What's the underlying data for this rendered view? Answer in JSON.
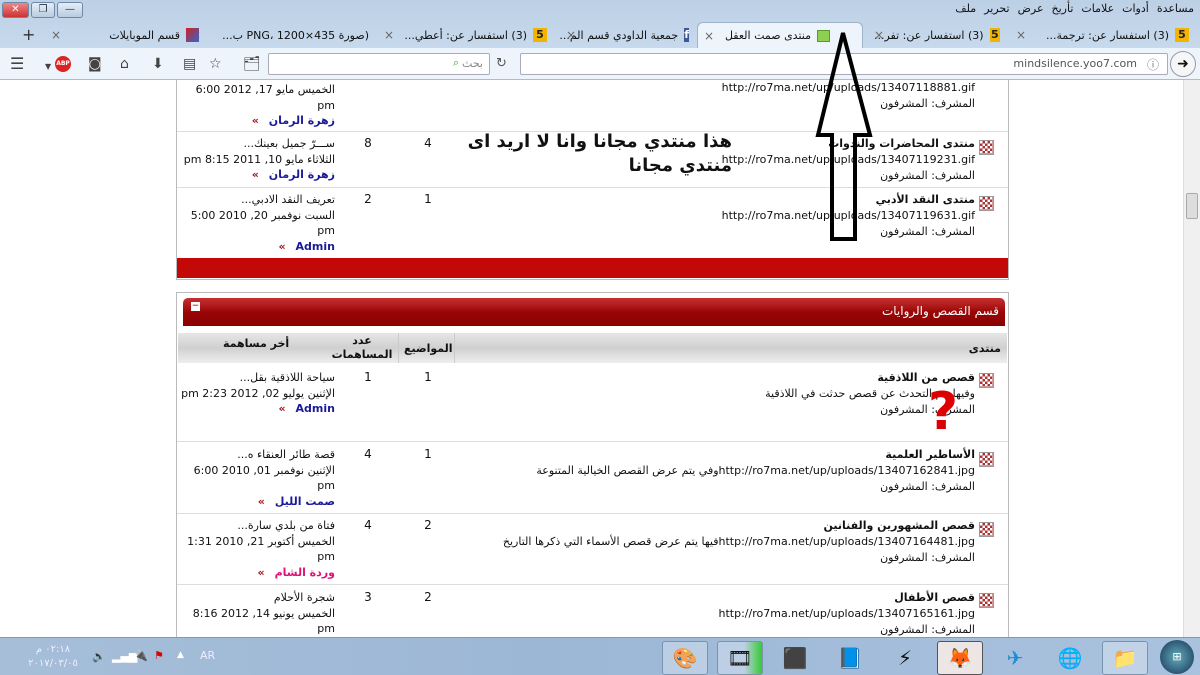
{
  "window": {
    "close": "✕",
    "restore": "❐",
    "minimize": "—"
  },
  "menu": [
    "ملف",
    "تحرير",
    "عرض",
    "تأريخ",
    "علامات",
    "أدوات",
    "مساعدة"
  ],
  "tabs": [
    {
      "label": "(3) استفسار عن: ترجمة...",
      "icon": "five-icon"
    },
    {
      "label": "(3) استفسار عن: تفر...",
      "icon": "five-icon"
    },
    {
      "label": "منتدى صمت العقل",
      "icon": "green-icon",
      "active": true
    },
    {
      "label": "جمعية الداودي قسم الم...",
      "icon": "facebook-icon"
    },
    {
      "label": "(3) استفسار عن: أعطي...",
      "icon": "five-icon"
    },
    {
      "label": "(صورة PNG، 1200×435 ب...",
      "icon": "image-icon"
    },
    {
      "label": "قسم الموبايلات",
      "icon": "site-icon"
    }
  ],
  "nav": {
    "url": "mindsilence.yoo7.com",
    "search_placeholder": "بحث",
    "abp": "ABP"
  },
  "annotation": {
    "line1": "هذا منتدي مجانا وانا لا اريد اى",
    "line2": "منتدي مجانا"
  },
  "section1": {
    "rows": [
      {
        "url": "http://ro7ma.net/up/uploads/13407118881.gif",
        "mod": "المشرف: المشرفون",
        "last_date": "الخميس مايو 17, 2012 6:00",
        "last_pm": "pm",
        "user": "زهرة الرمان"
      },
      {
        "name": "منتدى المحاضرات والندوات",
        "url": "http://ro7ma.net/up/uploads/13407119231.gif",
        "mod": "المشرف: المشرفون",
        "topics": "4",
        "posts": "8",
        "last_title": "ســـرّ جميل بعينك...",
        "last_date": "الثلاثاء مايو 10, 2011 8:15 pm",
        "user": "زهرة الرمان"
      },
      {
        "name": "منتدى النقد الأدبي",
        "url": "http://ro7ma.net/up/uploads/13407119631.gif",
        "mod": "المشرف: المشرفون",
        "topics": "1",
        "posts": "2",
        "last_title": "تعريف النقد الادبي...",
        "last_date": "السبت نوفمبر 20, 2010 5:00",
        "last_pm": "pm",
        "user": "Admin"
      }
    ]
  },
  "section2": {
    "title": "قسم القصص والروايات",
    "collapse": "−",
    "headers": {
      "forum": "منتدى",
      "topics": "المواضيع",
      "posts": "عدد المساهمات",
      "last": "أخر مساهمة"
    },
    "rows": [
      {
        "name": "قصص من اللاذقية",
        "desc": "وفيها يتم التحدث عن قصص حدثت في اللاذقية",
        "mod": "المشرف: المشرفون",
        "topics": "1",
        "posts": "1",
        "last_title": "سياحة اللاذقية بقل...",
        "last_date": "الإثنين يوليو 02, 2012 2:23 pm",
        "user": "Admin"
      },
      {
        "name": "الأساطير العلمية",
        "desc": "http://ro7ma.net/up/uploads/13407162841.jpgوفي يتم عرض القصص الخيالية المتنوعة",
        "mod": "المشرف: المشرفون",
        "topics": "1",
        "posts": "4",
        "last_title": "قصة طائر العنقاء ه...",
        "last_date": "الإثنين نوفمبر 01, 2010 6:00",
        "last_pm": "pm",
        "user": "صمت الليل"
      },
      {
        "name": "قصص المشهورين والفنانين",
        "desc": "http://ro7ma.net/up/uploads/13407164481.jpgفيها يتم عرض قصص الأسماء التي ذكرها التاريخ",
        "mod": "المشرف: المشرفون",
        "topics": "2",
        "posts": "4",
        "last_title": "فتاة من بلدي سارة...",
        "last_date": "الخميس أكتوبر 21, 2010 1:31",
        "last_pm": "pm",
        "user": "وردة الشام"
      },
      {
        "name": "قصص الأطفال",
        "desc": "http://ro7ma.net/up/uploads/13407165161.jpg",
        "mod": "المشرف: المشرفون",
        "topics": "2",
        "posts": "3",
        "last_title": "شجرة الأحلام",
        "last_date": "الخميس يونيو 14, 2012 8:16",
        "last_pm": "pm"
      }
    ]
  },
  "taskbar": {
    "time": "٠٢:١٨ م",
    "date": "٢٠١٧/٠٣/٠٥",
    "lang": "AR"
  },
  "colors": {
    "red": "#c40808",
    "link": "#1a1a9a",
    "pink": "#e0107a"
  }
}
